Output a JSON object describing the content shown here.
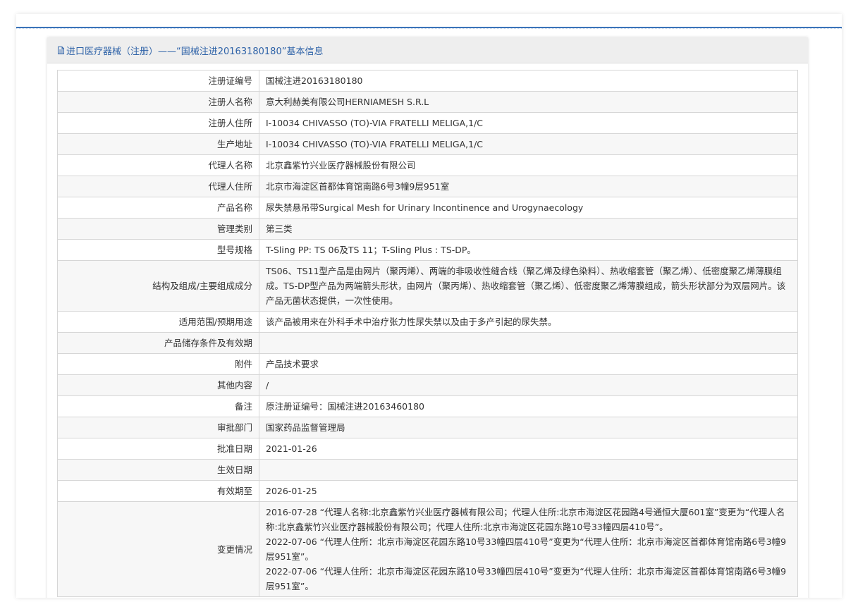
{
  "header": {
    "title": "进口医疗器械（注册）——“国械注进20163180180”基本信息"
  },
  "colors": {
    "accent": "#2f63a8",
    "rule": "#3a73b9",
    "header_bg": "#eeeeee"
  },
  "rows": [
    {
      "label": "注册证编号",
      "value": "国械注进20163180180"
    },
    {
      "label": "注册人名称",
      "value": "意大利赫美有限公司HERNIAMESH S.R.L"
    },
    {
      "label": "注册人住所",
      "value": "I-10034 CHIVASSO (TO)-VIA FRATELLI MELIGA,1/C"
    },
    {
      "label": "生产地址",
      "value": "I-10034 CHIVASSO (TO)-VIA FRATELLI MELIGA,1/C"
    },
    {
      "label": "代理人名称",
      "value": "北京鑫紫竹兴业医疗器械股份有限公司"
    },
    {
      "label": "代理人住所",
      "value": "北京市海淀区首都体育馆南路6号3幢9层951室"
    },
    {
      "label": "产品名称",
      "value": "尿失禁悬吊带Surgical Mesh for Urinary Incontinence and Urogynaecology"
    },
    {
      "label": "管理类别",
      "value": "第三类"
    },
    {
      "label": "型号规格",
      "value": "T-Sling PP: TS 06及TS 11；T-Sling Plus : TS-DP。"
    },
    {
      "label": "结构及组成/主要组成成分",
      "value": "TS06、TS11型产品是由网片（聚丙烯）、两端的非吸收性缝合线（聚乙烯及绿色染料）、热收缩套管（聚乙烯）、低密度聚乙烯薄膜组成。TS-DP型产品为两端箭头形状，由网片（聚丙烯）、热收缩套管（聚乙烯）、低密度聚乙烯薄膜组成，箭头形状部分为双层网片。该产品无菌状态提供，一次性使用。"
    },
    {
      "label": "适用范围/预期用途",
      "value": "该产品被用来在外科手术中治疗张力性尿失禁以及由于多产引起的尿失禁。"
    },
    {
      "label": "产品储存条件及有效期",
      "value": ""
    },
    {
      "label": "附件",
      "value": "产品技术要求"
    },
    {
      "label": "其他内容",
      "value": "/"
    },
    {
      "label": "备注",
      "value": "原注册证编号：国械注进20163460180"
    },
    {
      "label": "审批部门",
      "value": "国家药品监督管理局"
    },
    {
      "label": "批准日期",
      "value": "2021-01-26"
    },
    {
      "label": "生效日期",
      "value": ""
    },
    {
      "label": "有效期至",
      "value": "2026-01-25"
    }
  ],
  "changes": {
    "label": "变更情况",
    "entries": [
      "2016-07-28 “代理人名称:北京鑫紫竹兴业医疗器械有限公司；代理人住所:北京市海淀区花园路4号通恒大厦601室”变更为“代理人名称:北京鑫紫竹兴业医疗器械股份有限公司；代理人住所:北京市海淀区花园东路10号33幢四层410号”。",
      "2022-07-06 “代理人住所：北京市海淀区花园东路10号33幢四层410号”变更为“代理人住所：北京市海淀区首都体育馆南路6号3幢9层951室”。",
      "2022-07-06 “代理人住所：北京市海淀区花园东路10号33幢四层410号”变更为“代理人住所：北京市海淀区首都体育馆南路6号3幢9层951室”。"
    ]
  }
}
